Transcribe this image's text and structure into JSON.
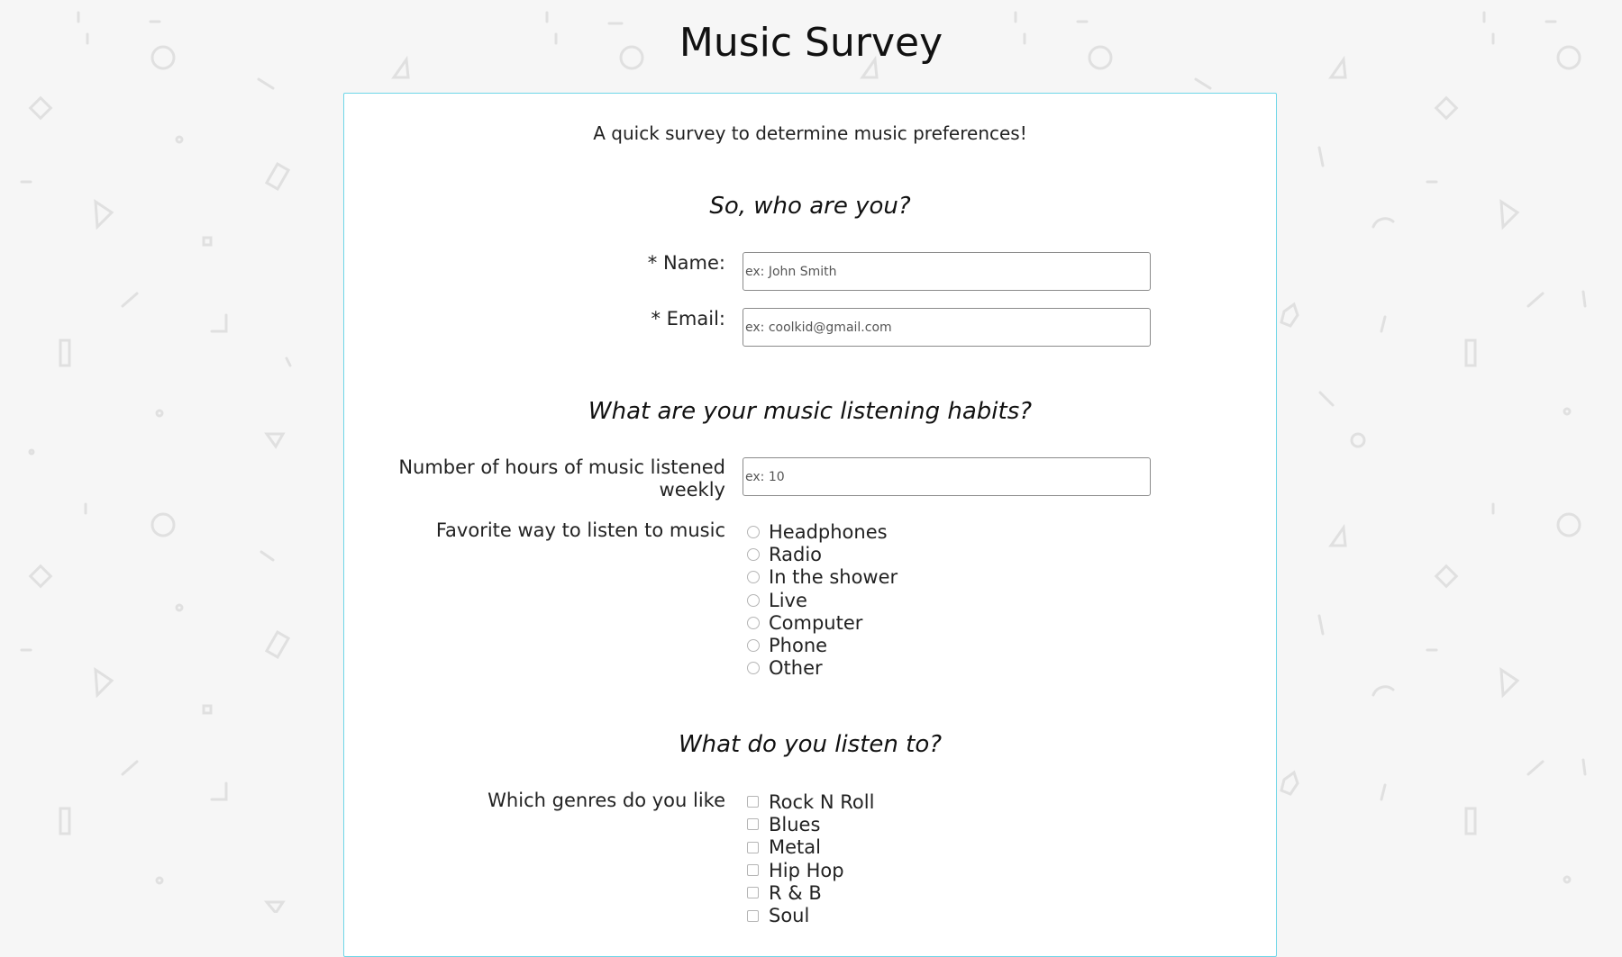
{
  "page": {
    "title": "Music Survey",
    "intro": "A quick survey to determine music preferences!"
  },
  "colors": {
    "background": "#f6f6f6",
    "card_border": "#6fd6e8",
    "pattern": "#e0e0e0"
  },
  "background_pattern_icons": [
    "circle-icon",
    "triangle-icon",
    "diamond-icon",
    "bracket-icon",
    "dot-icon",
    "dash-icon"
  ],
  "sections": {
    "identity": {
      "title": "So, who are you?",
      "name_label": "* Name:",
      "name_placeholder": "ex: John Smith",
      "email_label": "* Email:",
      "email_placeholder": "ex: coolkid@gmail.com"
    },
    "habits": {
      "title": "What are your music listening habits?",
      "hours_label": "Number of hours of music listened weekly",
      "hours_placeholder": "ex: 10",
      "favorite_label": "Favorite way to listen to music",
      "favorite_options": [
        "Headphones",
        "Radio",
        "In the shower",
        "Live",
        "Computer",
        "Phone",
        "Other"
      ]
    },
    "genres": {
      "title": "What do you listen to?",
      "genres_label": "Which genres do you like",
      "genre_options": [
        "Rock N Roll",
        "Blues",
        "Metal",
        "Hip Hop",
        "R & B",
        "Soul"
      ]
    }
  }
}
